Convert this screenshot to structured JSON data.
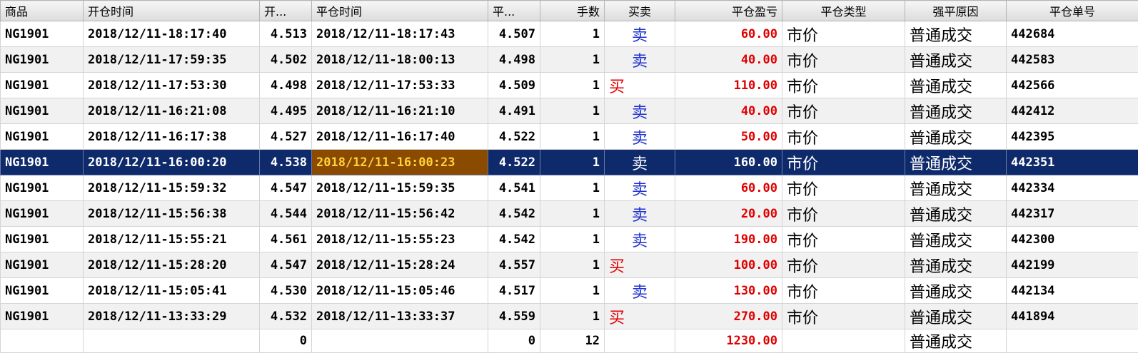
{
  "columns": [
    "商品",
    "开仓时间",
    "开...",
    "平仓时间",
    "平...",
    "手数",
    "买卖",
    "平仓盈亏",
    "平仓类型",
    "强平原因",
    "平仓单号"
  ],
  "rows": [
    {
      "symbol": "NG1901",
      "open_time": "2018/12/11-18:17:40",
      "open_price": "4.513",
      "close_time": "2018/12/11-18:17:43",
      "close_price": "4.507",
      "qty": "1",
      "side": "卖",
      "side_type": "sell",
      "pnl": "60.00",
      "close_type": "市价",
      "reason": "普通成交",
      "order_no": "442684"
    },
    {
      "symbol": "NG1901",
      "open_time": "2018/12/11-17:59:35",
      "open_price": "4.502",
      "close_time": "2018/12/11-18:00:13",
      "close_price": "4.498",
      "qty": "1",
      "side": "卖",
      "side_type": "sell",
      "pnl": "40.00",
      "close_type": "市价",
      "reason": "普通成交",
      "order_no": "442583"
    },
    {
      "symbol": "NG1901",
      "open_time": "2018/12/11-17:53:30",
      "open_price": "4.498",
      "close_time": "2018/12/11-17:53:33",
      "close_price": "4.509",
      "qty": "1",
      "side": "买",
      "side_type": "buy",
      "pnl": "110.00",
      "close_type": "市价",
      "reason": "普通成交",
      "order_no": "442566"
    },
    {
      "symbol": "NG1901",
      "open_time": "2018/12/11-16:21:08",
      "open_price": "4.495",
      "close_time": "2018/12/11-16:21:10",
      "close_price": "4.491",
      "qty": "1",
      "side": "卖",
      "side_type": "sell",
      "pnl": "40.00",
      "close_type": "市价",
      "reason": "普通成交",
      "order_no": "442412"
    },
    {
      "symbol": "NG1901",
      "open_time": "2018/12/11-16:17:38",
      "open_price": "4.527",
      "close_time": "2018/12/11-16:17:40",
      "close_price": "4.522",
      "qty": "1",
      "side": "卖",
      "side_type": "sell",
      "pnl": "50.00",
      "close_type": "市价",
      "reason": "普通成交",
      "order_no": "442395"
    },
    {
      "symbol": "NG1901",
      "open_time": "2018/12/11-16:00:20",
      "open_price": "4.538",
      "close_time": "2018/12/11-16:00:23",
      "close_price": "4.522",
      "qty": "1",
      "side": "卖",
      "side_type": "sell",
      "pnl": "160.00",
      "close_type": "市价",
      "reason": "普通成交",
      "order_no": "442351",
      "selected": true
    },
    {
      "symbol": "NG1901",
      "open_time": "2018/12/11-15:59:32",
      "open_price": "4.547",
      "close_time": "2018/12/11-15:59:35",
      "close_price": "4.541",
      "qty": "1",
      "side": "卖",
      "side_type": "sell",
      "pnl": "60.00",
      "close_type": "市价",
      "reason": "普通成交",
      "order_no": "442334"
    },
    {
      "symbol": "NG1901",
      "open_time": "2018/12/11-15:56:38",
      "open_price": "4.544",
      "close_time": "2018/12/11-15:56:42",
      "close_price": "4.542",
      "qty": "1",
      "side": "卖",
      "side_type": "sell",
      "pnl": "20.00",
      "close_type": "市价",
      "reason": "普通成交",
      "order_no": "442317"
    },
    {
      "symbol": "NG1901",
      "open_time": "2018/12/11-15:55:21",
      "open_price": "4.561",
      "close_time": "2018/12/11-15:55:23",
      "close_price": "4.542",
      "qty": "1",
      "side": "卖",
      "side_type": "sell",
      "pnl": "190.00",
      "close_type": "市价",
      "reason": "普通成交",
      "order_no": "442300"
    },
    {
      "symbol": "NG1901",
      "open_time": "2018/12/11-15:28:20",
      "open_price": "4.547",
      "close_time": "2018/12/11-15:28:24",
      "close_price": "4.557",
      "qty": "1",
      "side": "买",
      "side_type": "buy",
      "pnl": "100.00",
      "close_type": "市价",
      "reason": "普通成交",
      "order_no": "442199"
    },
    {
      "symbol": "NG1901",
      "open_time": "2018/12/11-15:05:41",
      "open_price": "4.530",
      "close_time": "2018/12/11-15:05:46",
      "close_price": "4.517",
      "qty": "1",
      "side": "卖",
      "side_type": "sell",
      "pnl": "130.00",
      "close_type": "市价",
      "reason": "普通成交",
      "order_no": "442134"
    },
    {
      "symbol": "NG1901",
      "open_time": "2018/12/11-13:33:29",
      "open_price": "4.532",
      "close_time": "2018/12/11-13:33:37",
      "close_price": "4.559",
      "qty": "1",
      "side": "买",
      "side_type": "buy",
      "pnl": "270.00",
      "close_type": "市价",
      "reason": "普通成交",
      "order_no": "441894"
    }
  ],
  "totals": {
    "open_price": "0",
    "close_price": "0",
    "qty": "12",
    "pnl": "1230.00",
    "reason": "普通成交"
  },
  "colors": {
    "selected_row": "#0f2a6b",
    "focus_cell": "#8a4a00",
    "focus_text": "#ffd23a",
    "sell": "#1f2fd0",
    "buy": "#e00000",
    "pnl": "#e00000"
  }
}
